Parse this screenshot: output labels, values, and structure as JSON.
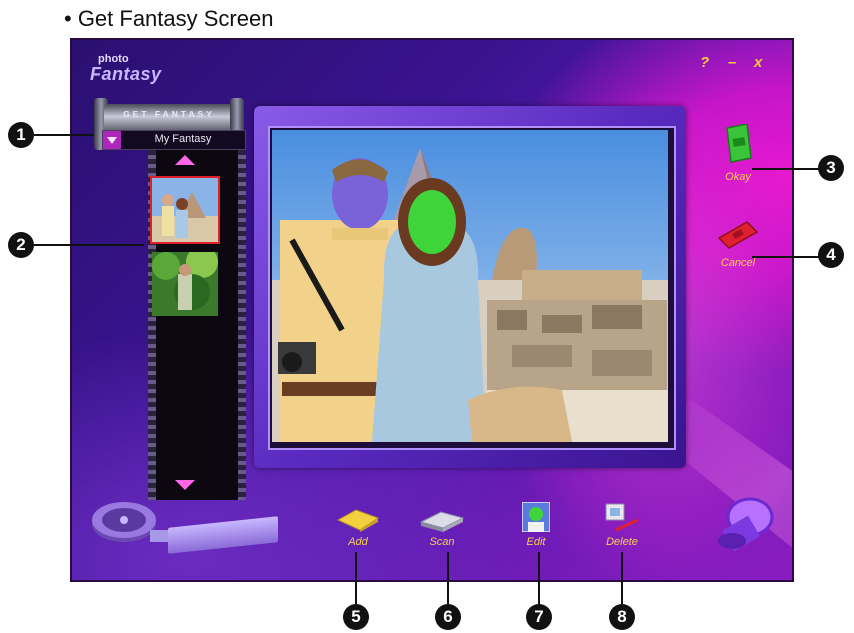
{
  "page_heading": "• Get Fantasy Screen",
  "app": {
    "logo": {
      "small": "photo",
      "big": "Fantasy"
    },
    "window_controls": {
      "help": "?",
      "minimize": "–",
      "close": "x"
    },
    "canister_title": "GET FANTASY",
    "dropdown": {
      "selected": "My Fantasy"
    },
    "thumbnails": [
      {
        "name": "couple-pyramids",
        "selected": true
      },
      {
        "name": "forest-scene",
        "selected": false
      }
    ],
    "side_buttons": {
      "okay": "Okay",
      "cancel": "Cancel"
    },
    "toolbar": {
      "add": "Add",
      "scan": "Scan",
      "edit": "Edit",
      "delete": "Delete"
    }
  },
  "callouts": [
    "1",
    "2",
    "3",
    "4",
    "5",
    "6",
    "7",
    "8"
  ],
  "colors": {
    "accent_label": "#f6d24a",
    "selection_border": "#e02028",
    "okay_ticket": "#3ac43a",
    "cancel_ticket": "#e02030"
  }
}
